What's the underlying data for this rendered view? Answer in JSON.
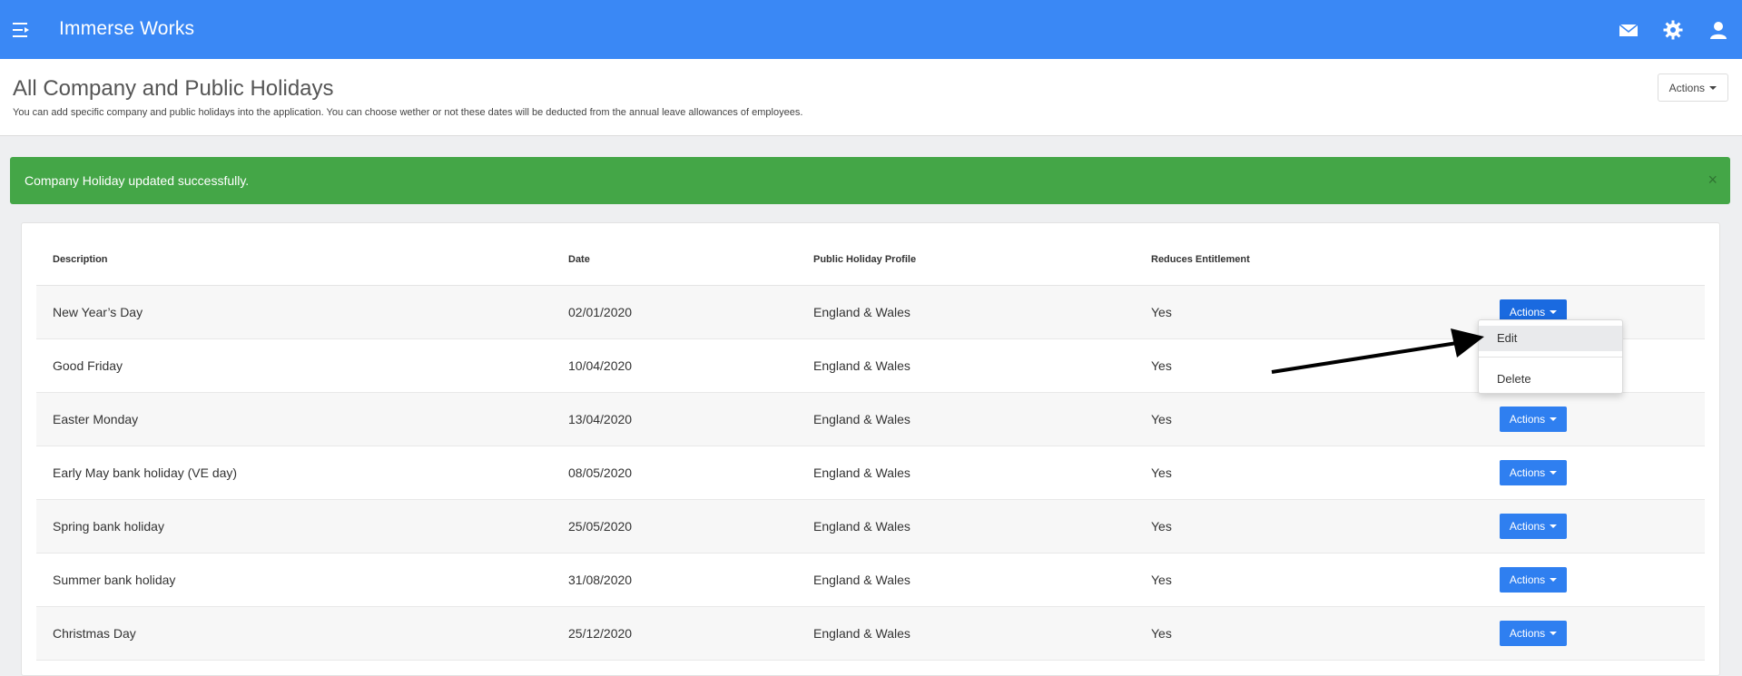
{
  "navbar": {
    "brand": "Immerse Works",
    "icons": [
      "menu-icon",
      "mail-icon",
      "gear-icon",
      "user-icon"
    ],
    "bg_color": "#3a88f5"
  },
  "page": {
    "title": "All Company and Public Holidays",
    "subtitle": "You can add specific company and public holidays into the application. You can choose wether or not these dates will be deducted from the annual leave allowances of employees.",
    "actions_label": "Actions"
  },
  "alert": {
    "message": "Company Holiday updated successfully.",
    "close": "×",
    "color": "#44a647"
  },
  "table": {
    "headers": {
      "description": "Description",
      "date": "Date",
      "profile": "Public Holiday Profile",
      "reduces": "Reduces Entitlement"
    },
    "rows": [
      {
        "description": "New Year’s Day",
        "date": "02/01/2020",
        "profile": "England & Wales",
        "reduces": "Yes",
        "action": "Actions"
      },
      {
        "description": "Good Friday",
        "date": "10/04/2020",
        "profile": "England & Wales",
        "reduces": "Yes",
        "action": "Actions"
      },
      {
        "description": "Easter Monday",
        "date": "13/04/2020",
        "profile": "England & Wales",
        "reduces": "Yes",
        "action": "Actions"
      },
      {
        "description": "Early May bank holiday (VE day)",
        "date": "08/05/2020",
        "profile": "England & Wales",
        "reduces": "Yes",
        "action": "Actions"
      },
      {
        "description": "Spring bank holiday",
        "date": "25/05/2020",
        "profile": "England & Wales",
        "reduces": "Yes",
        "action": "Actions"
      },
      {
        "description": "Summer bank holiday",
        "date": "31/08/2020",
        "profile": "England & Wales",
        "reduces": "Yes",
        "action": "Actions"
      },
      {
        "description": "Christmas Day",
        "date": "25/12/2020",
        "profile": "England & Wales",
        "reduces": "Yes",
        "action": "Actions"
      }
    ]
  },
  "dropdown": {
    "items": [
      "Edit",
      "Delete"
    ]
  },
  "accent_color": "#2f7ff0"
}
